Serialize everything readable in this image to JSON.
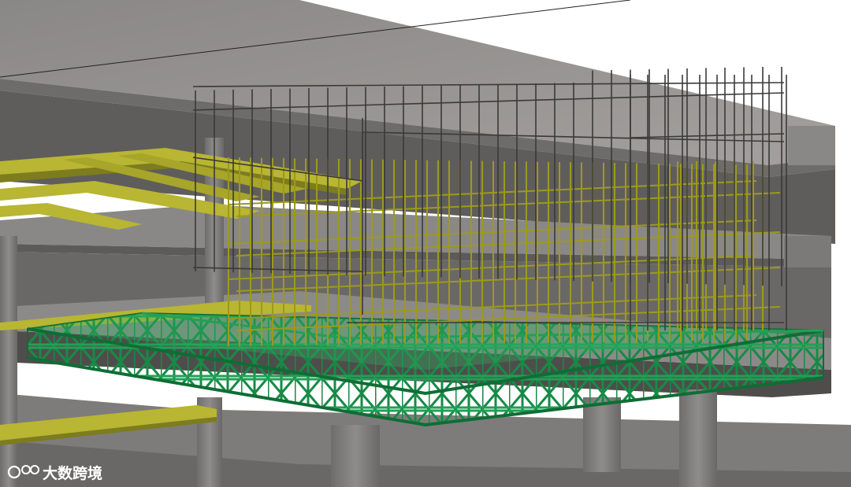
{
  "viewport": {
    "watermark_text": "大数跨境",
    "colors": {
      "concrete": "#8e8c8a",
      "slab_dark": "#6c6a68",
      "rebar_steel": "#3b3b3b",
      "rebar_yellow": "#9c9a1a",
      "yellow_beam": "#b8b632",
      "green_truss": "#1f9a52"
    }
  }
}
